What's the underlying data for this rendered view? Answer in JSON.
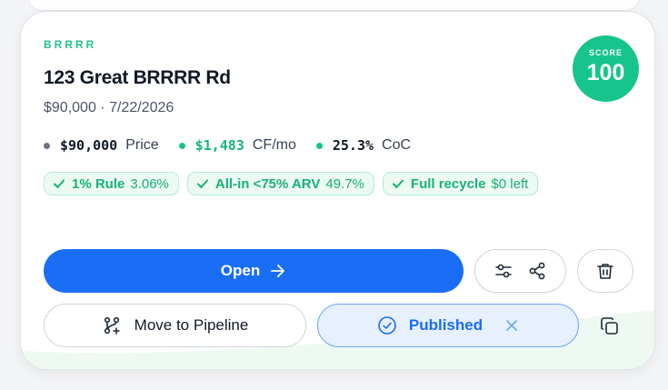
{
  "listing": {
    "tag": "BRRRR",
    "title": "123 Great BRRRR Rd",
    "price": "$90,000",
    "separator": "·",
    "date": "7/22/2026"
  },
  "score": {
    "label": "SCORE",
    "value": "100",
    "color": "#16c48c"
  },
  "metrics": [
    {
      "value": "$90,000",
      "label": "Price",
      "color": "#111827",
      "dot": "#6b7280"
    },
    {
      "value": "$1,483",
      "label": "CF/mo",
      "color": "#16b57e",
      "dot": "#16c48c"
    },
    {
      "value": "25.3%",
      "label": "CoC",
      "color": "#111827",
      "dot": "#16c48c"
    }
  ],
  "rules": [
    {
      "icon": "check-icon",
      "name": "1% Rule",
      "value": "3.06%"
    },
    {
      "icon": "check-icon",
      "name": "All-in <75% ARV",
      "value": "49.7%"
    },
    {
      "icon": "check-icon",
      "name": "Full recycle",
      "value": "$0 left"
    }
  ],
  "actions": {
    "open_label": "Open",
    "move_label": "Move to Pipeline",
    "published_label": "Published"
  },
  "colors": {
    "accent": "#1a6ef5",
    "success": "#16c48c"
  }
}
